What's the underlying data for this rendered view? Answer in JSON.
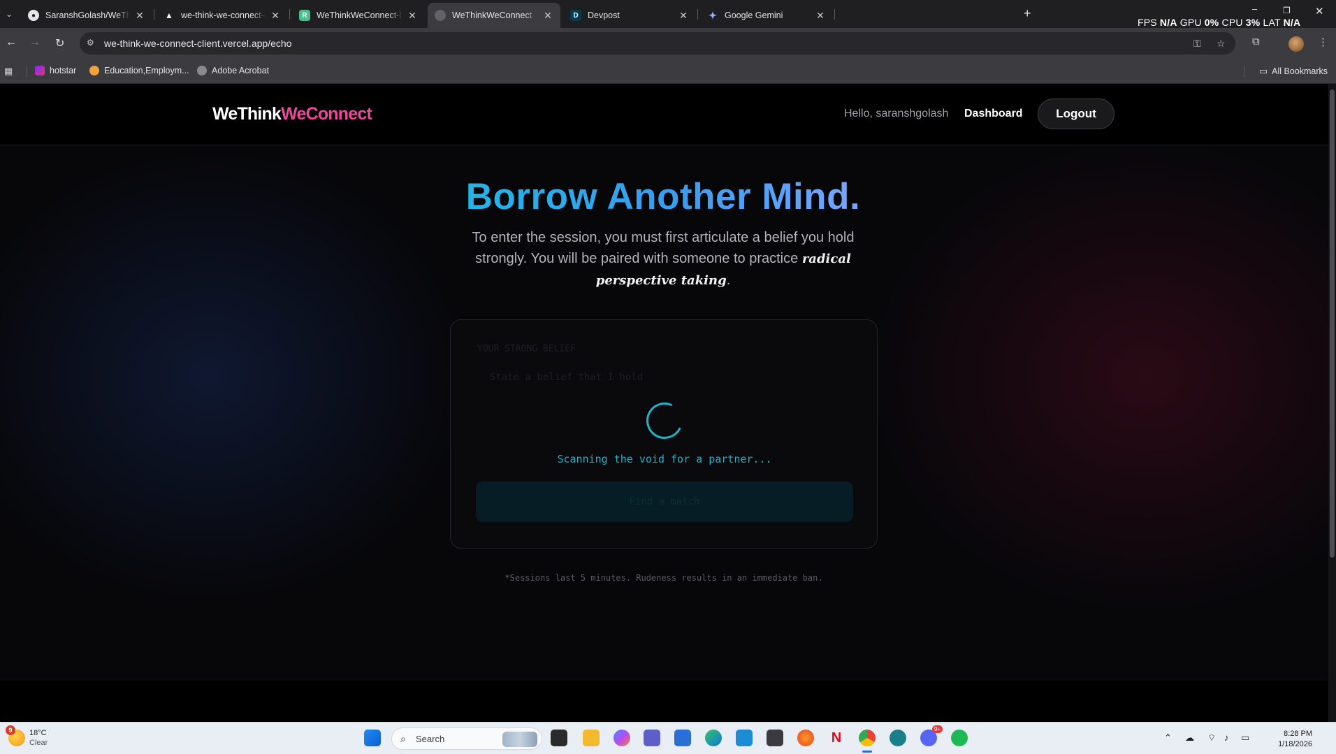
{
  "browser": {
    "tabs": [
      {
        "title": "SaranshGolash/WeThinkWeCon",
        "favicon": "github-icon",
        "active": false
      },
      {
        "title": "we-think-we-connect-client - O",
        "favicon": "vercel-icon",
        "active": false
      },
      {
        "title": "WeThinkWeConnect-backend -",
        "favicon": "render-icon",
        "active": false
      },
      {
        "title": "WeThinkWeConnect",
        "favicon": "globe-icon",
        "active": true
      },
      {
        "title": "Devpost",
        "favicon": "devpost-icon",
        "active": false
      },
      {
        "title": "Google Gemini",
        "favicon": "gemini-icon",
        "active": false
      }
    ],
    "url": "we-think-we-connect-client.vercel.app/echo",
    "perf_overlay": {
      "fps_label": "FPS",
      "fps": "N/A",
      "gpu_label": "GPU",
      "gpu": "0%",
      "cpu_label": "CPU",
      "cpu": "3%",
      "lat_label": "LAT",
      "lat": "N/A"
    },
    "bookmarks": [
      {
        "label": "hotstar",
        "color": "#7b2ff7"
      },
      {
        "label": "Education,Employm...",
        "color": "#f2a23a"
      },
      {
        "label": "Adobe Acrobat",
        "color": "#8a8a8e"
      }
    ],
    "all_bookmarks": "All Bookmarks"
  },
  "site": {
    "logo_part1": "WeThink",
    "logo_part2": "WeConnect",
    "greeting": "Hello, saranshgolash",
    "dashboard": "Dashboard",
    "logout": "Logout",
    "hero_title": "Borrow Another Mind.",
    "desc_before": "To enter the session, you must first articulate a belief you hold strongly. You will be paired with someone to practice",
    "desc_emphasis": "radical perspective taking",
    "desc_after": ".",
    "card": {
      "ghost_label": "YOUR STRONG BELIEF",
      "ghost_placeholder": "State a belief that I hold",
      "ghost_button": "Find a match",
      "status": "Scanning the void for a partner..."
    },
    "footnote": "*Sessions last 5 minutes. Rudeness results in an immediate ban.",
    "colors": {
      "accent_pink": "#ec4899",
      "accent_cyan": "#1fb3c7",
      "hero_gradient_start": "#22b5e6",
      "hero_gradient_end": "#7aa6ff"
    }
  },
  "taskbar": {
    "weather_temp": "18°C",
    "weather_cond": "Clear",
    "weather_badge": "9",
    "search_placeholder": "Search",
    "time": "8:28 PM",
    "date": "1/18/2026",
    "discord_badge": "9+"
  }
}
